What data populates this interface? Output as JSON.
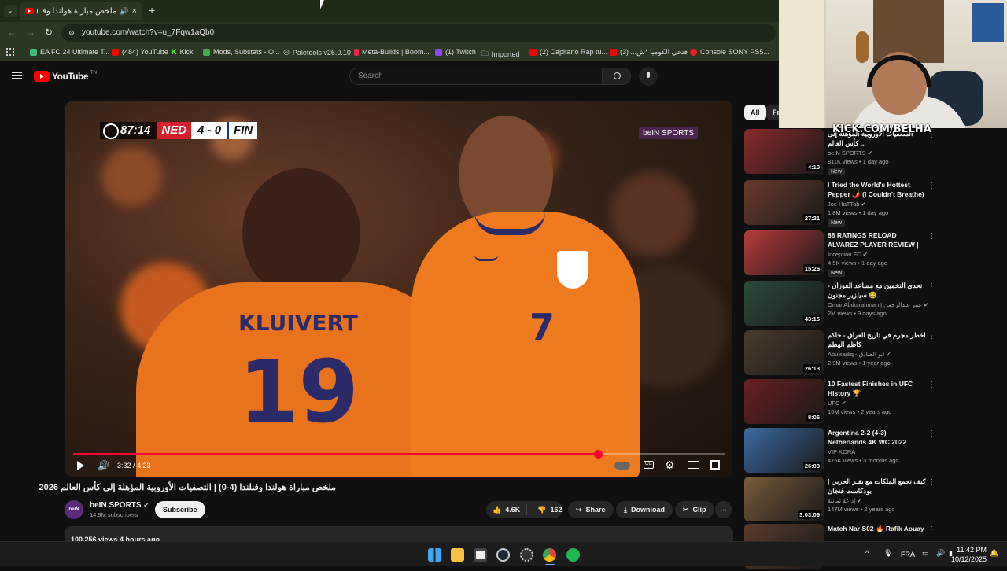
{
  "browser": {
    "tab_title": "ملخص مباراة هولندا وفـ (58)",
    "url": "youtube.com/watch?v=u_7Fqw1aQb0",
    "bookmarks": [
      "EA FC 24 Ultimate T...",
      "(484) YouTube",
      "Kick",
      "Mods, Substats - O...",
      "Paletools v26.0.10",
      "Meta-Builds | Boom...",
      "(1) Twitch",
      "Imported",
      "(2) Capitano Rap tu...",
      "فتحي الكوميا *ش... (3)",
      "Console SONY PS5..."
    ]
  },
  "youtube": {
    "logo": "YouTube",
    "logo_country": "TN",
    "search_placeholder": "Search"
  },
  "video": {
    "scorebug": {
      "clock": "87:14",
      "team1": "NED",
      "score": "4 - 0",
      "team2": "FIN"
    },
    "broadcaster": "beIN SPORTS",
    "time": "3:32 / 4:23",
    "progress": 0.805,
    "jersey_name": "KLUIVERT",
    "jersey_number_1": "19",
    "jersey_number_2": "7"
  },
  "meta": {
    "title": "ملخص مباراة هولندا وفنلندا (4-0) | التصفيات الأوروبية المؤهلة إلى كأس العالم 2026",
    "channel": "beIN SPORTS",
    "subscribers": "14.9M subscribers",
    "subscribe": "Subscribe",
    "likes": "4.6K",
    "dislikes": "162",
    "share": "Share",
    "download": "Download",
    "clip": "Clip",
    "views_line": "100,256 views  4 hours ago"
  },
  "chips": [
    "All",
    "Fr"
  ],
  "recommendations": [
    {
      "title": "السعفيات الأوروبية المؤهلة إلى كأس العالم ...",
      "channel": "beIN SPORTS",
      "verified": true,
      "stats": "811K views • 1 day ago",
      "duration": "4:10",
      "badge": "New",
      "thumb_color": "#8a2a2a"
    },
    {
      "title": "I Tried the World's Hottest Pepper 🌶️ (I Couldn't Breathe)",
      "channel": "Joe HaTTab",
      "verified": true,
      "stats": "1.8M views • 1 day ago",
      "duration": "27:21",
      "badge": "New",
      "thumb_color": "#6a3a2a"
    },
    {
      "title": "88 RATINGS RELOAD ALVAREZ PLAYER REVIEW | FC 26 ...",
      "channel": "Inception FC",
      "verified": true,
      "stats": "4.5K views • 1 day ago",
      "duration": "15:26",
      "badge": "New",
      "thumb_color": "#b93a3a"
    },
    {
      "title": "تحدي التخمين مع مساعد الفوزان - سيلزير مجنون 😂",
      "channel": "Omar Abdulrahman | عمر عبدالرحمن",
      "verified": true,
      "stats": "2M views • 9 days ago",
      "duration": "43:15",
      "badge": "",
      "thumb_color": "#2a4a3a"
    },
    {
      "title": "اخطر مجرم في تاريخ العراق - حاكم كاظم الهطم",
      "channel": "Abulsadiq - ابو الصادق",
      "verified": true,
      "stats": "2.9M views • 1 year ago",
      "duration": "26:13",
      "badge": "",
      "thumb_color": "#4a3a2a"
    },
    {
      "title": "10 Fastest Finishes in UFC History 🏆",
      "channel": "UFC",
      "verified": true,
      "stats": "15M views • 2 years ago",
      "duration": "8:06",
      "badge": "",
      "thumb_color": "#6a2020"
    },
    {
      "title": "Argentina 2-2 (4-3) Netherlands 4K WC 2022 Extended ...",
      "channel": "VIP KORA",
      "verified": false,
      "stats": "476K views • 3 months ago",
      "duration": "26:03",
      "badge": "",
      "thumb_color": "#3a6aa0"
    },
    {
      "title": "كيف تجمع الملكات مع بفـر الحربي | بودكاست فنجان",
      "channel": "إذاعة ثمانية",
      "verified": true,
      "stats": "147M views • 2 years ago",
      "duration": "3:03:09",
      "badge": "",
      "thumb_color": "#7a5a3a"
    },
    {
      "title": "Match Nar S02 🔥 Rafik Aouay",
      "channel": "Match",
      "verified": false,
      "stats": "",
      "duration": "",
      "badge": "",
      "thumb_color": "#5a3a2a"
    }
  ],
  "stream": {
    "overlay": "KICK.COM/BELHA"
  },
  "taskbar": {
    "lang": "FRA",
    "time": "11:42 PM",
    "date": "10/12/2025"
  }
}
